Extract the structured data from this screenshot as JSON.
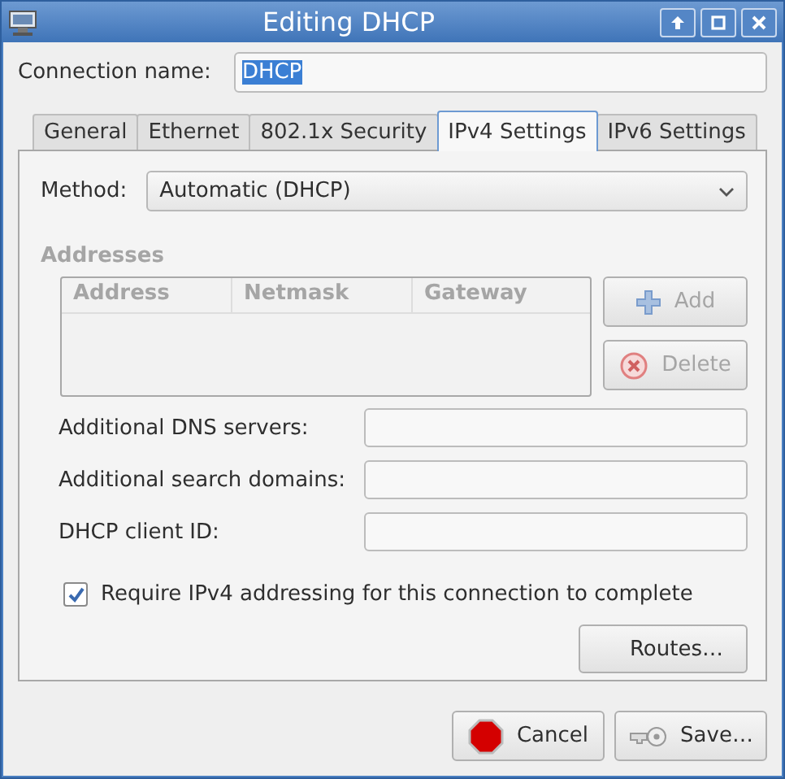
{
  "window": {
    "title": "Editing DHCP"
  },
  "connection_name": {
    "label": "Connection name:",
    "value": "DHCP",
    "selected": true
  },
  "tabs": [
    {
      "label": "General",
      "selected": false
    },
    {
      "label": "Ethernet",
      "selected": false
    },
    {
      "label": "802.1x Security",
      "selected": false
    },
    {
      "label": "IPv4 Settings",
      "selected": true
    },
    {
      "label": "IPv6 Settings",
      "selected": false
    }
  ],
  "method": {
    "label": "Method:",
    "value": "Automatic (DHCP)"
  },
  "addresses": {
    "title": "Addresses",
    "disabled": true,
    "columns": [
      "Address",
      "Netmask",
      "Gateway"
    ],
    "buttons": [
      "Add",
      "Delete"
    ]
  },
  "fields": [
    {
      "label": "Additional DNS servers:"
    },
    {
      "label": "Additional search domains:"
    },
    {
      "label": "DHCP client ID:"
    }
  ],
  "require": {
    "label": "Require IPv4 addressing for this connection to complete",
    "checked": true
  },
  "routes_button": "Routes…",
  "buttons": [
    "Cancel",
    "Save…"
  ]
}
